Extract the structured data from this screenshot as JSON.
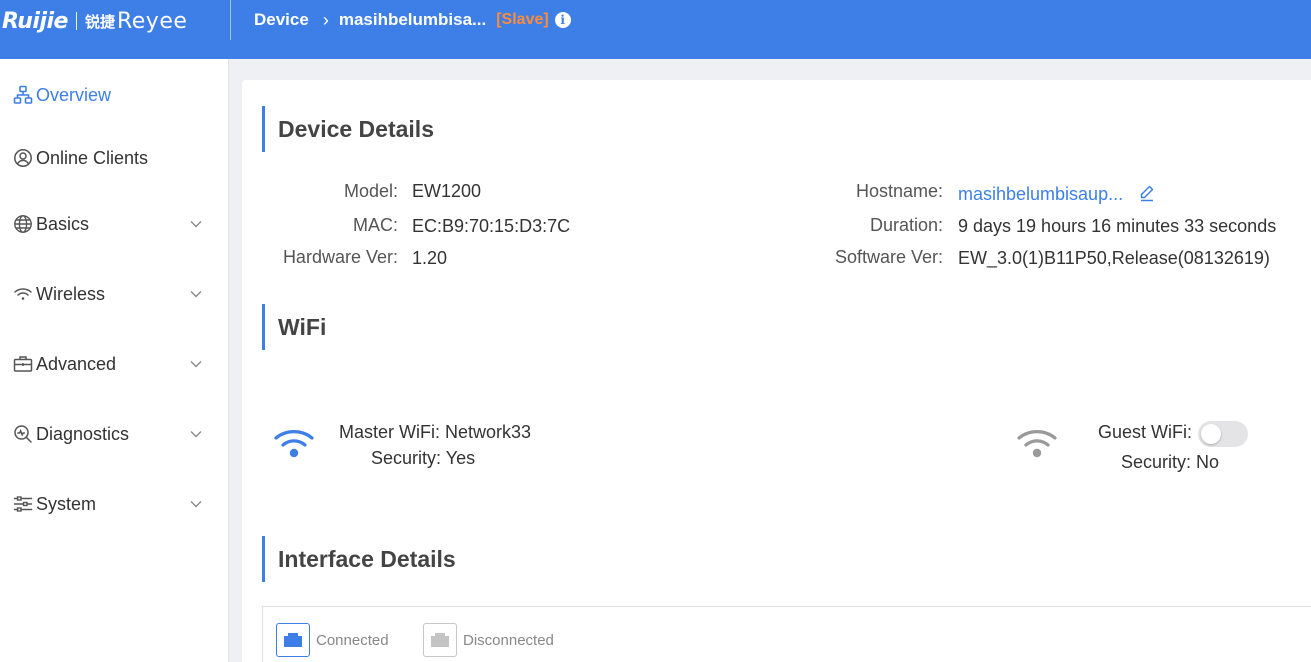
{
  "header": {
    "logo_brand": "Ruijie",
    "logo_cn": "锐捷",
    "logo_product": "Reyee",
    "breadcrumb_root": "Device",
    "breadcrumb_device": "masihbelumbisa...",
    "device_role": "[Slave]"
  },
  "sidebar": {
    "items": [
      {
        "label": "Overview",
        "icon": "topology-icon",
        "active": true
      },
      {
        "label": "Online Clients",
        "icon": "user-circle-icon"
      },
      {
        "label": "Basics",
        "icon": "globe-icon",
        "expandable": true
      },
      {
        "label": "Wireless",
        "icon": "wifi-icon",
        "expandable": true
      },
      {
        "label": "Advanced",
        "icon": "toolbox-icon",
        "expandable": true
      },
      {
        "label": "Diagnostics",
        "icon": "diagnostics-icon",
        "expandable": true
      },
      {
        "label": "System",
        "icon": "sliders-icon",
        "expandable": true
      }
    ]
  },
  "device_details": {
    "title": "Device Details",
    "model_label": "Model:",
    "model": "EW1200",
    "mac_label": "MAC:",
    "mac": "EC:B9:70:15:D3:7C",
    "hw_label": "Hardware Ver:",
    "hw": "1.20",
    "hostname_label": "Hostname:",
    "hostname": "masihbelumbisaup...",
    "duration_label": "Duration:",
    "duration": "9 days 19 hours 16 minutes 33 seconds",
    "sw_label": "Software Ver:",
    "sw": "EW_3.0(1)B11P50,Release(08132619)"
  },
  "wifi": {
    "title": "WiFi",
    "master_label": "Master WiFi:",
    "master_ssid": "Network33",
    "master_security_label": "Security:",
    "master_security": "Yes",
    "guest_label": "Guest WiFi:",
    "guest_enabled": false,
    "guest_security_label": "Security:",
    "guest_security": "No",
    "accent_color": "#3d7fe6",
    "inactive_color": "#9a9a9a"
  },
  "interface": {
    "title": "Interface Details",
    "connected_label": "Connected",
    "disconnected_label": "Disconnected"
  }
}
